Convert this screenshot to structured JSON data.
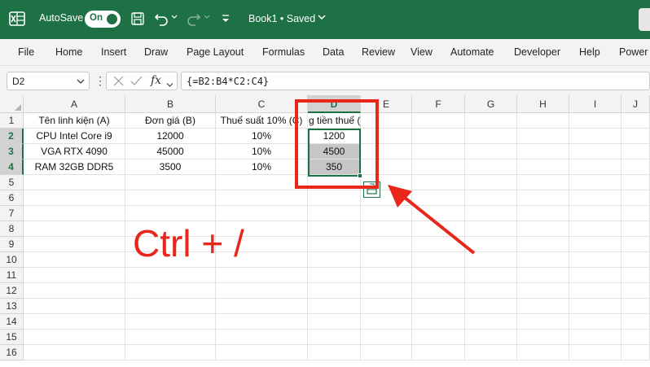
{
  "titlebar": {
    "autosave_label": "AutoSave",
    "autosave_state": "On",
    "document_title": "Book1 • Saved",
    "accent_color": "#1e7145"
  },
  "ribbon": {
    "tabs": [
      "File",
      "Home",
      "Insert",
      "Draw",
      "Page Layout",
      "Formulas",
      "Data",
      "Review",
      "View",
      "Automate",
      "Developer",
      "Help",
      "Power"
    ]
  },
  "formula_bar": {
    "name_box": "D2",
    "fx_label": "fx",
    "formula": "{=B2:B4*C2:C4}"
  },
  "sheet": {
    "columns": [
      "A",
      "B",
      "C",
      "D",
      "E",
      "F",
      "G",
      "H",
      "I",
      "J"
    ],
    "rows": [
      "1",
      "2",
      "3",
      "4",
      "5",
      "6",
      "7",
      "8",
      "9",
      "10",
      "11",
      "12",
      "13",
      "14",
      "15",
      "16"
    ],
    "selected_column": "D",
    "selected_rows": [
      "2",
      "3",
      "4"
    ],
    "headers": {
      "a": "Tên linh kiện (A)",
      "b": "Đơn giá (B)",
      "c": "Thuế suất 10% (C)",
      "d": "g tiền thuế (D"
    },
    "data_rows": [
      {
        "a": "CPU Intel Core i9",
        "b": "12000",
        "c": "10%",
        "d": "1200"
      },
      {
        "a": "VGA RTX 4090",
        "b": "45000",
        "c": "10%",
        "d": "4500"
      },
      {
        "a": "RAM 32GB DDR5",
        "b": "3500",
        "c": "10%",
        "d": "350"
      }
    ]
  },
  "annotation": {
    "text": "Ctrl + /",
    "color": "#e8261c"
  }
}
